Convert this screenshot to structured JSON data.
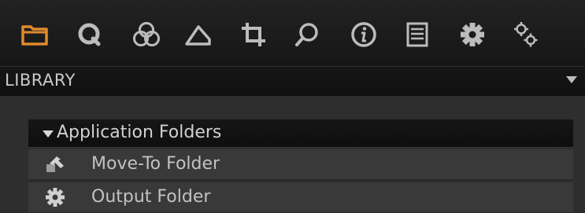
{
  "toolbar": {
    "tools": [
      {
        "icon": "folder-icon",
        "active": true
      },
      {
        "icon": "capture-icon"
      },
      {
        "icon": "color-icon"
      },
      {
        "icon": "exposure-icon"
      },
      {
        "icon": "crop-icon"
      },
      {
        "icon": "focus-icon"
      },
      {
        "icon": "info-icon"
      },
      {
        "icon": "list-icon"
      },
      {
        "icon": "gear-icon"
      },
      {
        "icon": "gears-icon"
      }
    ],
    "active_color": "#e08a2b",
    "icon_color": "#bcbcbc"
  },
  "library": {
    "title": "LIBRARY",
    "group": {
      "title": "Application Folders",
      "items": [
        {
          "label": "Move-To Folder",
          "icon": "move-to-folder-icon"
        },
        {
          "label": "Output Folder",
          "icon": "gear-icon"
        }
      ]
    }
  }
}
